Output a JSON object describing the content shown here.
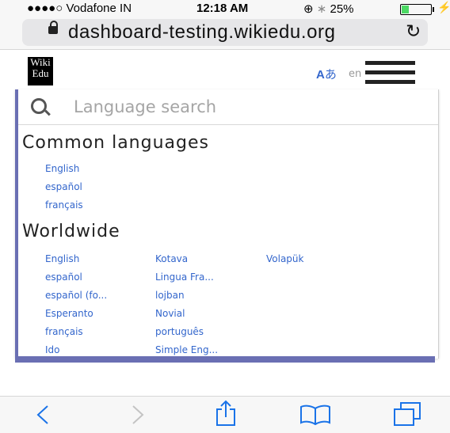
{
  "status": {
    "carrier": "●●●●○ Vodafone IN",
    "time": "12:18 AM",
    "battery": "25%",
    "battery_level": 0.25
  },
  "browser": {
    "url": "dashboard-testing.wikiedu.org"
  },
  "site": {
    "logo_line1": "Wiki",
    "logo_line2": "Edu",
    "lang_code": "en"
  },
  "panel": {
    "search_placeholder": "Language search",
    "common_title": "Common languages",
    "common": [
      "English",
      "español",
      "français"
    ],
    "worldwide_title": "Worldwide",
    "worldwide": [
      [
        "English",
        "español",
        "español (fo...",
        "Esperanto",
        "français",
        "Ido"
      ],
      [
        "Kotava",
        "Lingua Fra...",
        "lojban",
        "Novial",
        "português",
        "Simple Eng..."
      ],
      [
        "Volapük"
      ]
    ]
  },
  "toolbar": {
    "icons": [
      "back-icon",
      "forward-icon",
      "share-icon",
      "bookmarks-icon",
      "tabs-icon"
    ]
  }
}
